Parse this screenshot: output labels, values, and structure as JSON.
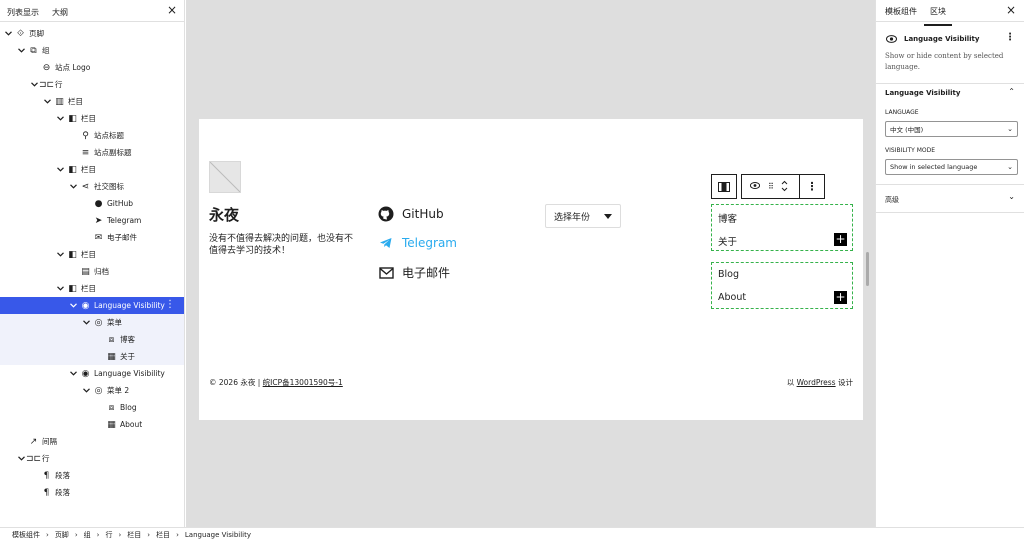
{
  "left_panel": {
    "tabs": [
      "列表显示",
      "大纲"
    ],
    "tree": [
      {
        "label": "页脚",
        "icon": "template-part-icon"
      },
      {
        "label": "组",
        "icon": "group-icon"
      },
      {
        "label": "站点 Logo",
        "icon": "site-logo-icon"
      },
      {
        "label": "行",
        "icon": "row-icon"
      },
      {
        "label": "栏目",
        "icon": "columns-icon"
      },
      {
        "label": "栏目",
        "icon": "column-icon"
      },
      {
        "label": "站点标题",
        "icon": "map-pin-icon"
      },
      {
        "label": "站点副标题",
        "icon": "tagline-icon"
      },
      {
        "label": "栏目",
        "icon": "column-icon"
      },
      {
        "label": "社交图标",
        "icon": "share-icon"
      },
      {
        "label": "GitHub",
        "icon": "github-icon"
      },
      {
        "label": "Telegram",
        "icon": "telegram-icon"
      },
      {
        "label": "电子邮件",
        "icon": "mail-icon"
      },
      {
        "label": "栏目",
        "icon": "column-icon"
      },
      {
        "label": "归档",
        "icon": "archive-icon"
      },
      {
        "label": "栏目",
        "icon": "column-icon"
      },
      {
        "label": "Language Visibility",
        "icon": "eye-icon"
      },
      {
        "label": "菜单",
        "icon": "navigation-icon"
      },
      {
        "label": "博客",
        "icon": "custom-link-icon"
      },
      {
        "label": "关于",
        "icon": "page-icon"
      },
      {
        "label": "Language Visibility",
        "icon": "eye-icon"
      },
      {
        "label": "菜单 2",
        "icon": "navigation-icon"
      },
      {
        "label": "Blog",
        "icon": "custom-link-icon"
      },
      {
        "label": "About",
        "icon": "page-icon"
      },
      {
        "label": "间隔",
        "icon": "spacer-icon"
      },
      {
        "label": "行",
        "icon": "row-icon"
      },
      {
        "label": "段落",
        "icon": "paragraph-icon"
      },
      {
        "label": "段落",
        "icon": "paragraph-icon"
      }
    ]
  },
  "canvas": {
    "site_title": "永夜",
    "tagline": "没有不值得去解决的问题，也没有不值得去学习的技术！",
    "social": [
      {
        "label": "GitHub",
        "icon": "github-icon",
        "color": "#1e1e1e"
      },
      {
        "label": "Telegram",
        "icon": "telegram-icon",
        "color": "#2aabee"
      },
      {
        "label": "电子邮件",
        "icon": "mail-icon",
        "color": "#1e1e1e"
      }
    ],
    "archive_select": "选择年份",
    "menu_zh": [
      "博客",
      "关于"
    ],
    "menu_en": [
      "Blog",
      "About"
    ],
    "footer_left_prefix": "© 2026 永夜 | ",
    "footer_left_link": "皖ICP备13001590号-1",
    "footer_right_prefix": "以 ",
    "footer_right_link": "WordPress",
    "footer_right_suffix": " 设计",
    "selection_color": "#35b24a",
    "accent": "#3858e9"
  },
  "right_panel": {
    "tabs": [
      "模板组件",
      "区块"
    ],
    "block_name": "Language Visibility",
    "block_desc": "Show or hide content by selected language.",
    "section_title": "Language Visibility",
    "language_label": "LANGUAGE",
    "language_value": "中文 (中国)",
    "mode_label": "VISIBILITY MODE",
    "mode_value": "Show in selected language",
    "advanced": "高级"
  },
  "breadcrumb": [
    "模板组件",
    "页脚",
    "组",
    "行",
    "栏目",
    "栏目",
    "Language Visibility"
  ]
}
